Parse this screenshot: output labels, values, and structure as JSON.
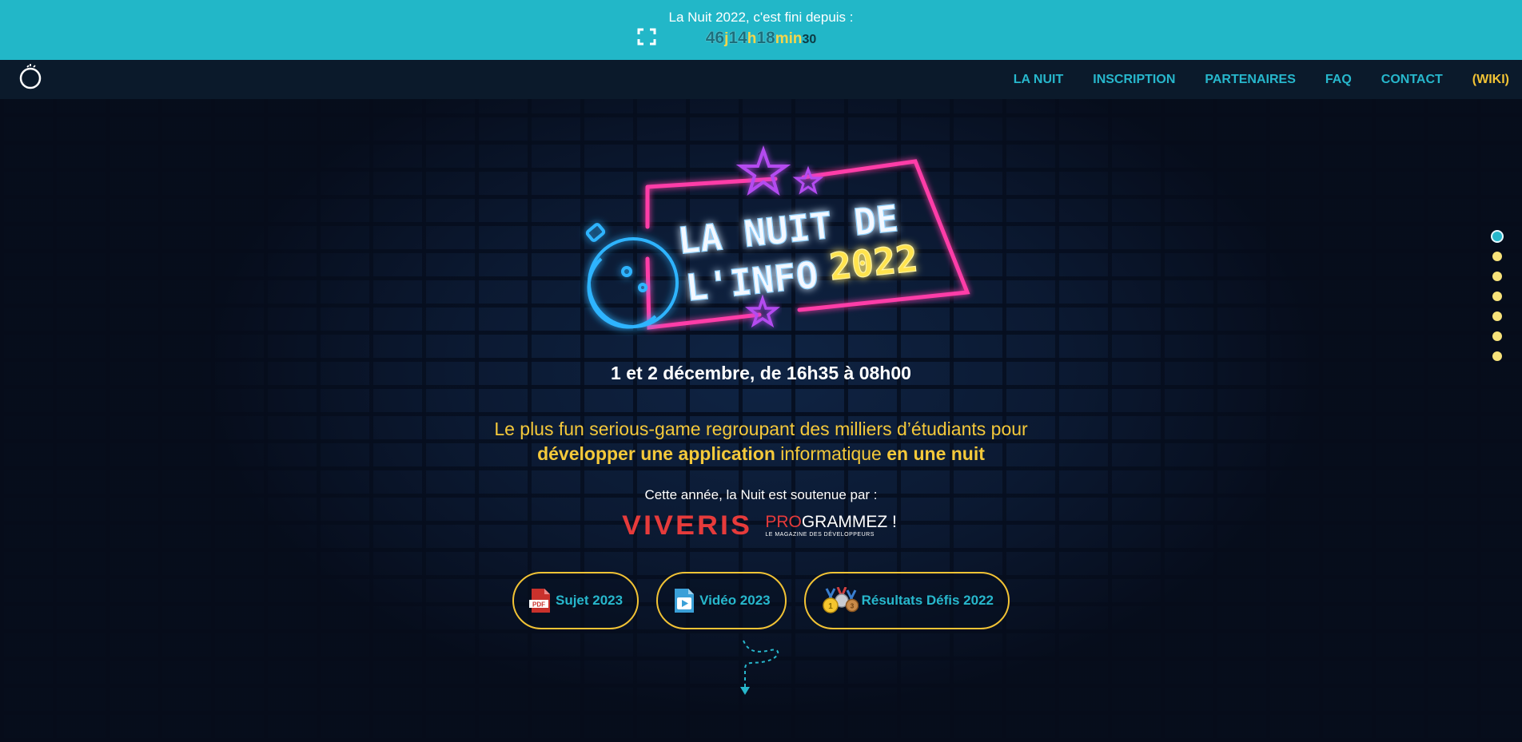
{
  "banner": {
    "title": "La Nuit 2022, c'est fini depuis :",
    "countdown": {
      "days": "46",
      "days_unit": "j",
      "hours": "14",
      "hours_unit": "h",
      "minutes": "18",
      "minutes_unit": "min",
      "seconds": "30"
    }
  },
  "nav": {
    "items": [
      {
        "label": "LA NUIT"
      },
      {
        "label": "INSCRIPTION"
      },
      {
        "label": "PARTENAIRES"
      },
      {
        "label": "FAQ"
      },
      {
        "label": "CONTACT"
      },
      {
        "label": "(WIKI)"
      }
    ]
  },
  "hero": {
    "logo_line1": "LA NUIT DE",
    "logo_line2": "L'INFO",
    "logo_year": "2022",
    "date": "1 et 2 décembre, de 16h35 à 08h00",
    "tagline_part1": "Le plus fun serious-game regroupant des milliers d’étudiants pour",
    "tagline_bold1": "développer une application",
    "tagline_part2": "informatique",
    "tagline_bold2": "en une nuit",
    "sponsor_text": "Cette année, la Nuit est soutenue par :",
    "sponsors": {
      "viveris": "VIVERIS",
      "programmez_pro": "PRO",
      "programmez_rest": "GRAMMEZ !",
      "programmez_sub": "LE MAGAZINE DES DÉVELOPPEURS"
    }
  },
  "buttons": [
    {
      "label": "Sujet 2023",
      "icon": "pdf-icon"
    },
    {
      "label": "Vidéo 2023",
      "icon": "video-file-icon"
    },
    {
      "label": "Résultats Défis 2022",
      "icon": "medals-icon"
    }
  ],
  "colors": {
    "banner": "#22b7c8",
    "accent_cyan": "#27b7cc",
    "accent_yellow": "#f2c335",
    "neon_pink": "#ff3ca8",
    "neon_purple": "#a040e8"
  },
  "section_dots": {
    "count": 7,
    "active_index": 0
  }
}
